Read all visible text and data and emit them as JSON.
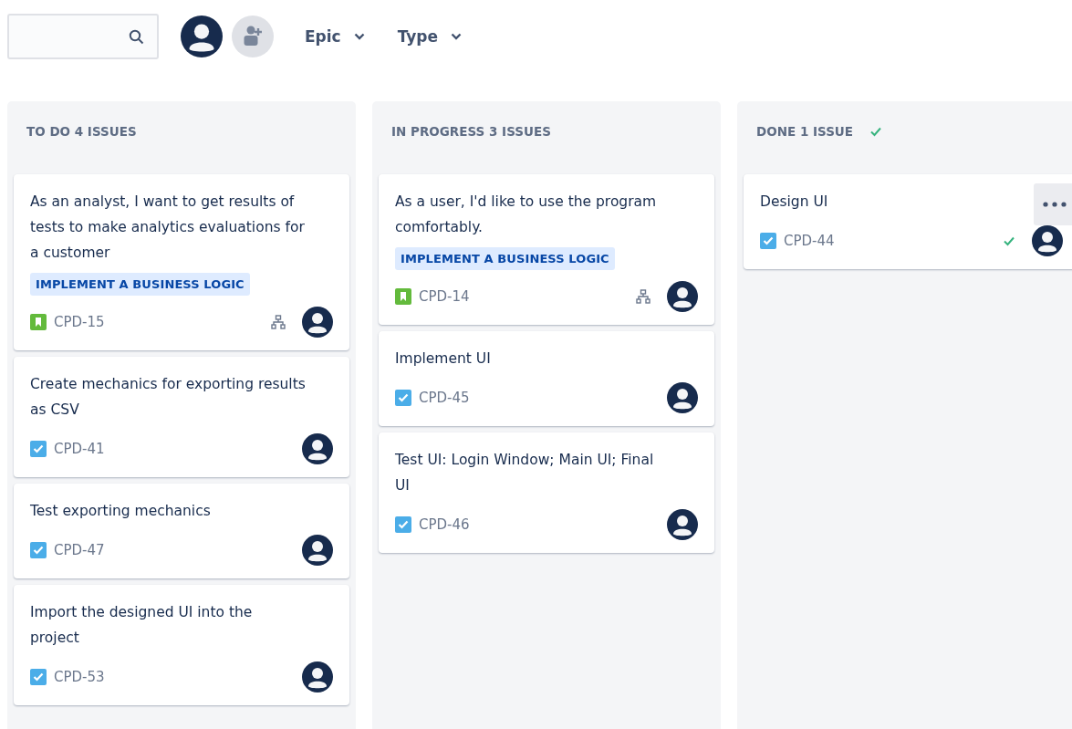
{
  "toolbar": {
    "filters": [
      {
        "label": "Epic"
      },
      {
        "label": "Type"
      }
    ]
  },
  "columns": [
    {
      "title": "TO DO 4 ISSUES",
      "done_mark": false,
      "cards": [
        {
          "kind": "story",
          "summary": "As an analyst, I want to get results of tests to make analytics evaluations for a customer",
          "epic": "IMPLEMENT A BUSINESS LOGIC",
          "key": "CPD-15",
          "subtasks": true,
          "done": false,
          "menu": false
        },
        {
          "kind": "task",
          "summary": "Create mechanics for exporting results as CSV",
          "key": "CPD-41",
          "subtasks": false,
          "done": false,
          "menu": false
        },
        {
          "kind": "task",
          "summary": "Test exporting mechanics",
          "key": "CPD-47",
          "subtasks": false,
          "done": false,
          "menu": false
        },
        {
          "kind": "task",
          "summary": "Import the designed UI into the project",
          "key": "CPD-53",
          "subtasks": false,
          "done": false,
          "menu": false
        }
      ]
    },
    {
      "title": "IN PROGRESS 3 ISSUES",
      "done_mark": false,
      "cards": [
        {
          "kind": "story",
          "summary": "As a user, I'd like to use the program comfortably.",
          "epic": "IMPLEMENT A BUSINESS LOGIC",
          "key": "CPD-14",
          "subtasks": true,
          "done": false,
          "menu": false
        },
        {
          "kind": "task",
          "summary": "Implement UI",
          "key": "CPD-45",
          "subtasks": false,
          "done": false,
          "menu": false
        },
        {
          "kind": "task",
          "summary": "Test UI: Login Window; Main UI; Final UI",
          "key": "CPD-46",
          "subtasks": false,
          "done": false,
          "menu": false
        }
      ]
    },
    {
      "title": "DONE 1 ISSUE",
      "done_mark": true,
      "cards": [
        {
          "kind": "task",
          "summary": "Design UI",
          "key": "CPD-44",
          "subtasks": false,
          "done": true,
          "menu": true
        }
      ]
    }
  ]
}
